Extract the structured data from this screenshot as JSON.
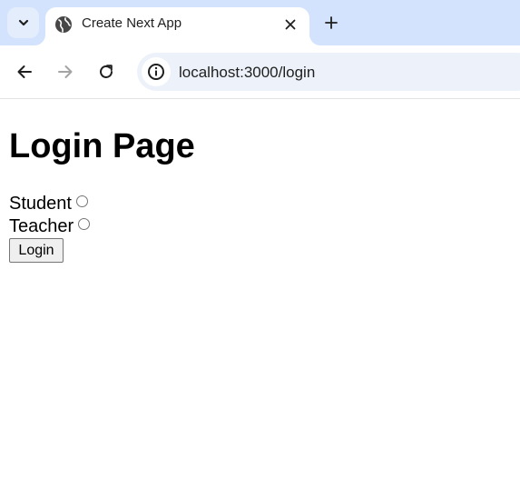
{
  "browser": {
    "tab": {
      "title": "Create Next App",
      "favicon": "globe-icon"
    },
    "address_bar": {
      "url": "localhost:3000/login",
      "site_info_icon": "info-icon"
    },
    "icons": {
      "tab_search": "chevron-down-icon",
      "close_tab": "close-icon",
      "new_tab": "plus-icon",
      "back": "arrow-left-icon",
      "forward": "arrow-right-icon",
      "reload": "reload-icon"
    },
    "colors": {
      "tab_strip": "#d3e3fd",
      "omnibox": "#edf2fa"
    }
  },
  "page": {
    "title": "Login Page",
    "roles": [
      {
        "label": "Student",
        "checked": false
      },
      {
        "label": "Teacher",
        "checked": false
      }
    ],
    "login_button_label": "Login"
  }
}
